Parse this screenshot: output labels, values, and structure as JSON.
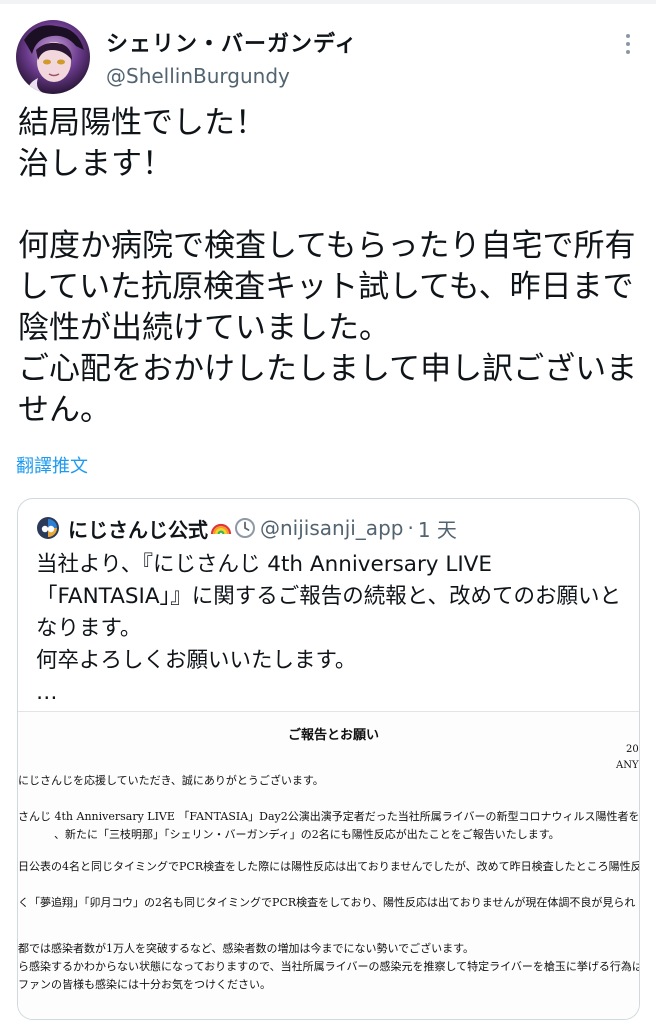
{
  "tweet": {
    "author_name": "シェリン・バーガンディ",
    "author_handle": "@ShellinBurgundy",
    "text": "結局陽性でした！\n治します！\n\n何度か病院で検査してもらったり自宅で所有していた抗原検査キット試しても、昨日まで陰性が出続けていました。\nご心配をおかけしたしまして申し訳ございません。",
    "translate_label": "翻譯推文",
    "more_icon": "more-icon"
  },
  "quote": {
    "author_name": "にじさんじ公式",
    "emoji_1": "rainbow-icon",
    "emoji_2": "clock-icon",
    "author_handle": "@nijisanji_app",
    "separator": "·",
    "time": "1 天",
    "text": "当社より、『にじさんじ 4th Anniversary LIVE 「FANTASIA」』に関するご報告の続報と、改めてのお願いとなります。\n何卒よろしくお願いいたします。\n…",
    "document": {
      "title": "ご報告とお願い",
      "date1": "20",
      "date2": "ANYO",
      "lines": [
        "にじさんじを応援していただき、誠にありがとうございます。",
        "さんじ 4th Anniversary LIVE 「FANTASIA」Day2公演出演予定者だった当社所属ライバーの新型コロナウィルス陽性者を公",
        "、新たに「三枝明那」「シェリン・バーガンディ」の2名にも陽性反応が出たことをご報告いたします。",
        "日公表の4名と同じタイミングでPCR検査をした際には陽性反応は出ておりませんでしたが、改めて昨日検査したところ陽性反",
        "く「夢追翔」「卯月コウ」の2名も同じタイミングでPCR検査をしており、陽性反応は出ておりませんが現在体調不良が見られ",
        "都では感染者数が1万人を突破するなど、感染者数の増加は今までにない勢いでございます。",
        "ら感染するかわからない状態になっておりますので、当社所属ライバーの感染元を推察して特定ライバーを槍玉に挙げる行為は",
        "ファンの皆様も感染には十分お気をつけください。"
      ]
    }
  }
}
